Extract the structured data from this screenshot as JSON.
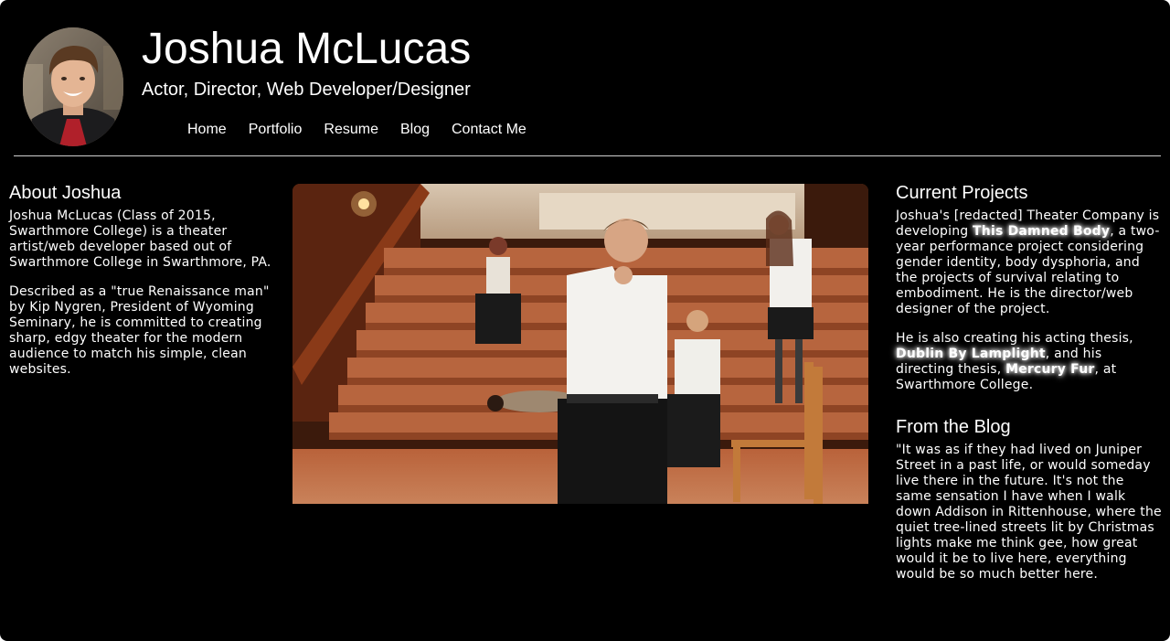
{
  "header": {
    "title": "Joshua McLucas",
    "tagline": "Actor, Director, Web Developer/Designer",
    "avatar_icon": "profile-photo"
  },
  "nav": {
    "items": [
      "Home",
      "Portfolio",
      "Resume",
      "Blog",
      "Contact Me"
    ]
  },
  "about": {
    "heading": "About Joshua",
    "paragraphs": [
      "Joshua McLucas (Class of 2015, Swarthmore College) is a theater artist/web developer based out of Swarthmore College in Swarthmore, PA.",
      "Described as a \"true Renaissance man\" by Kip Nygren, President of Wyoming Seminary, he is committed to creating sharp, edgy theater for the modern audience to match his simple, clean websites."
    ]
  },
  "hero": {
    "image_icon": "theater-production-photo"
  },
  "projects": {
    "heading": "Current Projects",
    "p1_before": "Joshua's [redacted] Theater Company is developing ",
    "p1_highlight": "This Damned Body",
    "p1_after": ", a two-year performance project considering gender identity, body dysphoria, and the projects of survival relating to embodiment. He is the director/web designer of the project.",
    "p2_before": "He is also creating his acting thesis, ",
    "p2_highlight1": "Dublin By Lamplight",
    "p2_middle": ", and his directing thesis, ",
    "p2_highlight2": "Mercury Fur",
    "p2_after": ", at Swarthmore College."
  },
  "blog": {
    "heading": "From the Blog",
    "excerpt": "\"It was as if they had lived on Juniper Street in a past life, or would someday live there in the future. It's not the same sensation I have when I walk down Addison in Rittenhouse, where the quiet tree-lined streets lit by Christmas lights make me think gee, how great would it be to live here, everything would be so much better here."
  },
  "colors": {
    "background": "#000000",
    "text": "#ffffff",
    "divider": "#cfcfcf"
  }
}
